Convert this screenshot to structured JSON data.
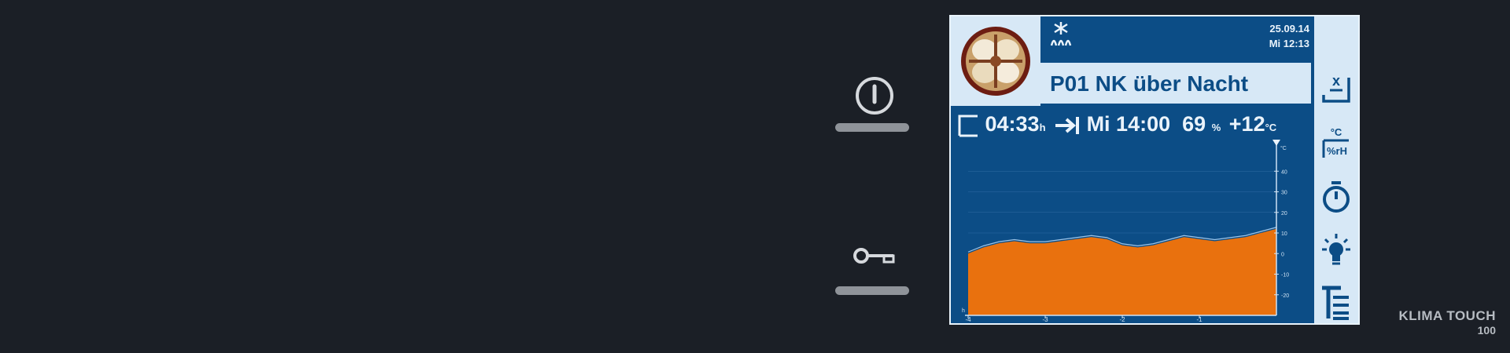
{
  "screen": {
    "date": "25.09.14",
    "time": "Mi 12:13",
    "program_name": "P01 NK über Nacht",
    "info": {
      "duration": "04:33",
      "duration_unit": "h",
      "end_time": "Mi 14:00",
      "humidity": "69",
      "humidity_unit": "%",
      "temperature": "+12",
      "temperature_unit": "°C"
    },
    "icons": {
      "thumbnail": "pastry-product-image",
      "mode": "fan-heating-icon"
    }
  },
  "toolbar": {
    "items": [
      {
        "icon": "manual-mode-icon"
      },
      {
        "icon": "temperature-humidity-settings-icon",
        "label_top": "°C",
        "label_bottom": "%rH"
      },
      {
        "icon": "timer-icon"
      },
      {
        "icon": "light-icon"
      },
      {
        "icon": "program-list-icon"
      }
    ]
  },
  "side_buttons": [
    {
      "icon": "power-icon"
    },
    {
      "icon": "key-icon"
    }
  ],
  "brand": {
    "line1": "KLIMA TOUCH",
    "line2": "100"
  },
  "colors": {
    "screen_bg": "#0c4d86",
    "chart_fill": "#e9710e",
    "panel_light": "#d7e8f6",
    "page_bg": "#1b1f26"
  },
  "chart_data": {
    "type": "area",
    "x_unit": "h",
    "y_unit": "°C",
    "xlim": [
      -4,
      0
    ],
    "ylim": [
      -30,
      50
    ],
    "x_ticks": [
      -4,
      -3,
      -2,
      -1
    ],
    "y_ticks": [
      40,
      30,
      20,
      10,
      0,
      -10,
      -20
    ],
    "series": [
      {
        "x": [
          -4,
          -3.8,
          -3.6,
          -3.4,
          -3.2,
          -3.0,
          -2.8,
          -2.6,
          -2.4,
          -2.2,
          -2.0,
          -1.8,
          -1.6,
          -1.4,
          -1.2,
          -1.0,
          -0.8,
          -0.6,
          -0.4,
          -0.2,
          0
        ],
        "values": [
          0,
          3,
          5,
          6,
          5,
          5,
          6,
          7,
          8,
          7,
          4,
          3,
          4,
          6,
          8,
          7,
          6,
          7,
          8,
          10,
          12
        ]
      }
    ]
  }
}
